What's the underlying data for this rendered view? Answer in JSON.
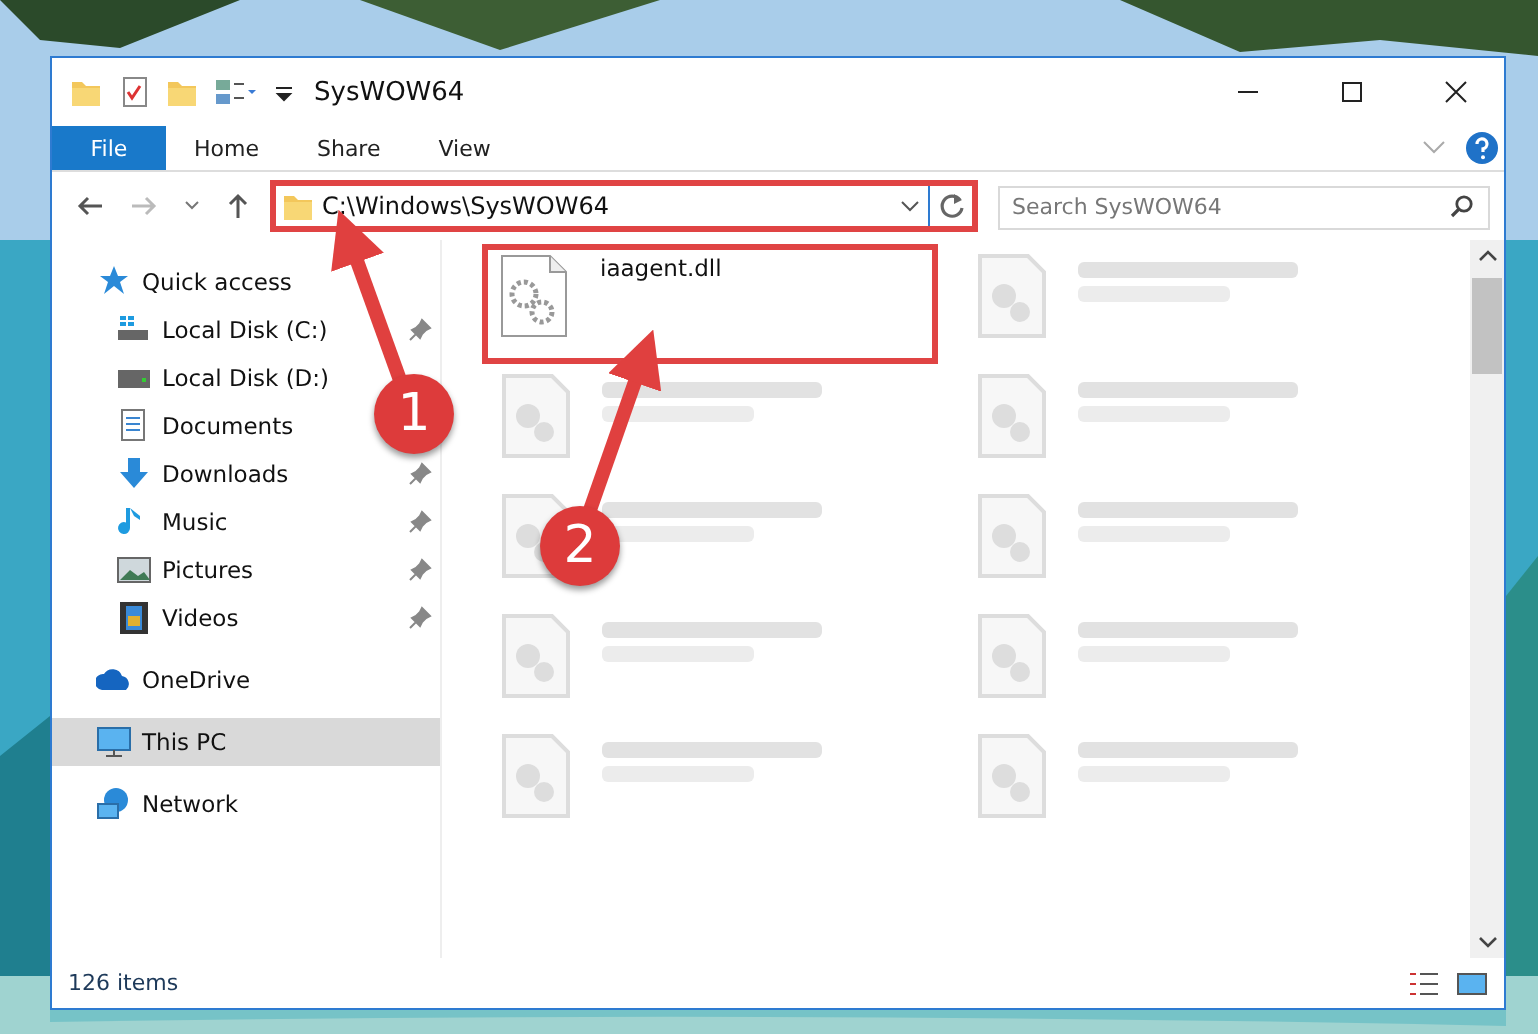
{
  "window": {
    "title": "SysWOW64"
  },
  "ribbon": {
    "file_button": "File",
    "tabs": [
      {
        "label": "Home"
      },
      {
        "label": "Share"
      },
      {
        "label": "View"
      }
    ]
  },
  "address": {
    "value": "C:\\Windows\\SysWOW64",
    "highlighted": true
  },
  "search": {
    "placeholder": "Search SysWOW64"
  },
  "sidebar": {
    "items": [
      {
        "label": "Quick access",
        "kind": "star",
        "selected": false,
        "children": [
          {
            "label": "Local Disk (C:)",
            "kind": "drive-windows",
            "pinned": true,
            "selected": false
          },
          {
            "label": "Local Disk (D:)",
            "kind": "drive",
            "pinned": false,
            "selected": false
          },
          {
            "label": "Documents",
            "kind": "documents",
            "pinned": false,
            "selected": false
          },
          {
            "label": "Downloads",
            "kind": "downloads",
            "pinned": true,
            "selected": false
          },
          {
            "label": "Music",
            "kind": "music",
            "pinned": true,
            "selected": false
          },
          {
            "label": "Pictures",
            "kind": "pictures",
            "pinned": true,
            "selected": false
          },
          {
            "label": "Videos",
            "kind": "videos",
            "pinned": true,
            "selected": false
          }
        ]
      },
      {
        "label": "OneDrive",
        "kind": "cloud",
        "selected": false
      },
      {
        "label": "This PC",
        "kind": "pc",
        "selected": true
      },
      {
        "label": "Network",
        "kind": "network",
        "selected": false
      }
    ]
  },
  "files": [
    {
      "name": "iaagent.dll",
      "blurred": false,
      "highlighted": true
    },
    {
      "blurred": true,
      "highlighted": false
    },
    {
      "blurred": true,
      "highlighted": false
    },
    {
      "blurred": true,
      "highlighted": false
    },
    {
      "blurred": true,
      "highlighted": false
    },
    {
      "blurred": true,
      "highlighted": false
    },
    {
      "blurred": true,
      "highlighted": false
    },
    {
      "blurred": true,
      "highlighted": false
    },
    {
      "blurred": true,
      "highlighted": false
    },
    {
      "blurred": true,
      "highlighted": false
    }
  ],
  "status_bar": {
    "text": "126 items"
  },
  "callouts": [
    {
      "number": "1"
    },
    {
      "number": "2"
    }
  ]
}
